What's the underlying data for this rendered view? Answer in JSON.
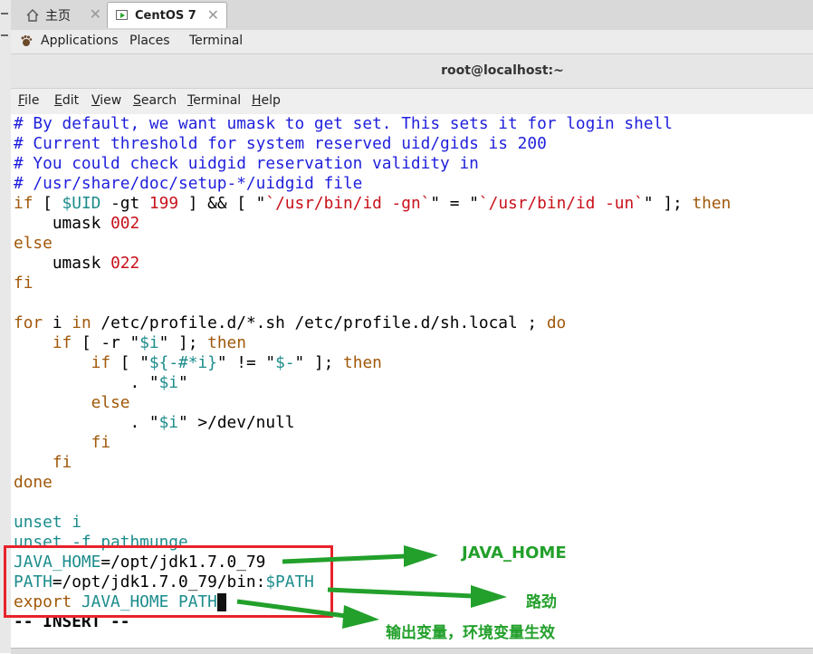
{
  "tabs": [
    {
      "label": "主页",
      "icon": "home-icon",
      "close": "✕"
    },
    {
      "label": "CentOS 7",
      "icon": "vm-icon",
      "close": "✕"
    }
  ],
  "gnome_menu": {
    "applications": "Applications",
    "places": "Places",
    "terminal": "Terminal"
  },
  "window": {
    "title": "root@localhost:~"
  },
  "menubar": [
    {
      "u": "F",
      "rest": "ile"
    },
    {
      "u": "E",
      "rest": "dit"
    },
    {
      "u": "V",
      "rest": "iew"
    },
    {
      "u": "S",
      "rest": "earch"
    },
    {
      "u": "T",
      "rest": "erminal"
    },
    {
      "u": "H",
      "rest": "elp"
    }
  ],
  "colors": {
    "comment": "#1f1fdc",
    "keyword": "#a0580a",
    "number": "#c8101a",
    "string": "#c8101a",
    "variable": "#1c8c8c",
    "normal": "#000000",
    "annotation": "#22a02b",
    "highlight_box": "#e8232c"
  },
  "code_lines": [
    [
      [
        "c",
        "# By default, we want umask to get set. This sets it for login shell"
      ]
    ],
    [
      [
        "c",
        "# Current threshold for system reserved uid/gids is 200"
      ]
    ],
    [
      [
        "c",
        "# You could check uidgid reservation validity in"
      ]
    ],
    [
      [
        "c",
        "# /usr/share/doc/setup-*/uidgid file"
      ]
    ],
    [
      [
        "k",
        "if"
      ],
      [
        "n",
        " [ "
      ],
      [
        "v",
        "$UID"
      ],
      [
        "n",
        " -gt "
      ],
      [
        "r",
        "199"
      ],
      [
        "n",
        " ] && [ \""
      ],
      [
        "r",
        "`/usr/bin/id -gn`"
      ],
      [
        "n",
        "\" = \""
      ],
      [
        "r",
        "`/usr/bin/id -un`"
      ],
      [
        "n",
        "\" ]; "
      ],
      [
        "k",
        "then"
      ]
    ],
    [
      [
        "n",
        "    umask "
      ],
      [
        "r",
        "002"
      ]
    ],
    [
      [
        "k",
        "else"
      ]
    ],
    [
      [
        "n",
        "    umask "
      ],
      [
        "r",
        "022"
      ]
    ],
    [
      [
        "k",
        "fi"
      ]
    ],
    [
      [
        "n",
        ""
      ]
    ],
    [
      [
        "k",
        "for"
      ],
      [
        "n",
        " i "
      ],
      [
        "k",
        "in"
      ],
      [
        "n",
        " /etc/profile.d/*.sh /etc/profile.d/sh.local ; "
      ],
      [
        "k",
        "do"
      ]
    ],
    [
      [
        "n",
        "    "
      ],
      [
        "k",
        "if"
      ],
      [
        "n",
        " [ -r \""
      ],
      [
        "v",
        "$i"
      ],
      [
        "n",
        "\" ]; "
      ],
      [
        "k",
        "then"
      ]
    ],
    [
      [
        "n",
        "        "
      ],
      [
        "k",
        "if"
      ],
      [
        "n",
        " [ \""
      ],
      [
        "v",
        "${-#*i}"
      ],
      [
        "n",
        "\" != \""
      ],
      [
        "v",
        "$-"
      ],
      [
        "n",
        "\" ]; "
      ],
      [
        "k",
        "then"
      ]
    ],
    [
      [
        "n",
        "            . \""
      ],
      [
        "v",
        "$i"
      ],
      [
        "n",
        "\""
      ]
    ],
    [
      [
        "n",
        "        "
      ],
      [
        "k",
        "else"
      ]
    ],
    [
      [
        "n",
        "            . \""
      ],
      [
        "v",
        "$i"
      ],
      [
        "n",
        "\" >/dev/null"
      ]
    ],
    [
      [
        "n",
        "        "
      ],
      [
        "k",
        "fi"
      ]
    ],
    [
      [
        "n",
        "    "
      ],
      [
        "k",
        "fi"
      ]
    ],
    [
      [
        "k",
        "done"
      ]
    ],
    [
      [
        "n",
        ""
      ]
    ],
    [
      [
        "v",
        "unset i"
      ]
    ],
    [
      [
        "v",
        "unset -f pathmunge"
      ]
    ],
    [
      [
        "v",
        "JAVA_HOME"
      ],
      [
        "n",
        "=/opt/jdk1.7.0_79"
      ]
    ],
    [
      [
        "v",
        "PATH"
      ],
      [
        "n",
        "=/opt/jdk1.7.0_79/bin:"
      ],
      [
        "v",
        "$PATH"
      ]
    ],
    [
      [
        "k",
        "export"
      ],
      [
        "v",
        " JAVA_HOME PATH"
      ]
    ],
    [
      [
        "n",
        "-- INSERT --"
      ]
    ]
  ],
  "annotations": [
    {
      "text": "JAVA_HOME"
    },
    {
      "text": "路劲"
    },
    {
      "text": "输出变量，环境变量生效"
    }
  ]
}
